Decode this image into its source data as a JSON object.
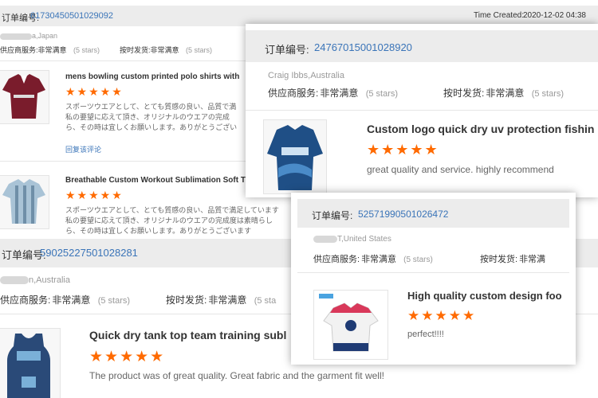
{
  "card1": {
    "order_label": "订单编号:",
    "order_no": "61730450501029092",
    "time_label": "Time Created:",
    "time_value": "2020-12-02 04:38",
    "buyer": "a,Japan",
    "svc_label": "供应商服务:",
    "svc_value": "非常满意",
    "svc_stars": "(5 stars)",
    "ship_label": "按时发货:",
    "ship_value": "非常满意",
    "ship_stars": "(5 stars)",
    "item1_title": "mens bowling custom printed polo shirts with",
    "item1_stars": "★★★★★",
    "item1_text1": "スポーツウエアとして、とても質感の良い、品質で満",
    "item1_text2": "私の要望に応えて頂き、オリジナルのウエアの完成",
    "item1_text3": "ら、その時は宜しくお願いします。ありがとうござい",
    "reply_link": "回复该评论",
    "item2_title": "Breathable Custom Workout Sublimation Soft T",
    "item2_stars": "★★★★★",
    "item2_text1": "スポーツウエアとして、とても質感の良い、品質で満足しています",
    "item2_text2": "私の要望に応えて頂き、オリジナルのウエアの完成度は素晴らし",
    "item2_text3": "ら、その時は宜しくお願いします。ありがとうございます"
  },
  "card2": {
    "order_label": "订单编号:",
    "order_no": "24767015001028920",
    "buyer": "Craig Ibbs,Australia",
    "svc_label": "供应商服务:",
    "svc_value": "非常满意",
    "svc_stars": "(5 stars)",
    "ship_label": "按时发货:",
    "ship_value": "非常满意",
    "ship_stars": "(5 stars)",
    "title": "Custom logo quick dry uv protection fishin",
    "stars": "★★★★★",
    "review": "great quality and service. highly recommend"
  },
  "card3": {
    "order_label": "订单编号:",
    "order_no": "59025227501028281",
    "buyer": "n,Australia",
    "svc_label": "供应商服务:",
    "svc_value": "非常满意",
    "svc_stars": "(5 stars)",
    "ship_label": "按时发货:",
    "ship_value": "非常满意",
    "ship_stars": "(5 sta",
    "title": "Quick dry tank top team training subl",
    "stars": "★★★★★",
    "review": "The product was of great quality. Great fabric and the garment fit well!"
  },
  "card4": {
    "order_label": "订单编号:",
    "order_no": "52571990501026472",
    "buyer": "T,United States",
    "svc_label": "供应商服务:",
    "svc_value": "非常满意",
    "svc_stars": "(5 stars)",
    "ship_label": "按时发货:",
    "ship_value": "非常满",
    "title": "High quality custom design foo",
    "stars": "★★★★★",
    "review": "perfect!!!!"
  },
  "colors": {
    "link_blue": "#3a74b8",
    "star_orange": "#ff6a00",
    "header_gray": "#ececec"
  }
}
